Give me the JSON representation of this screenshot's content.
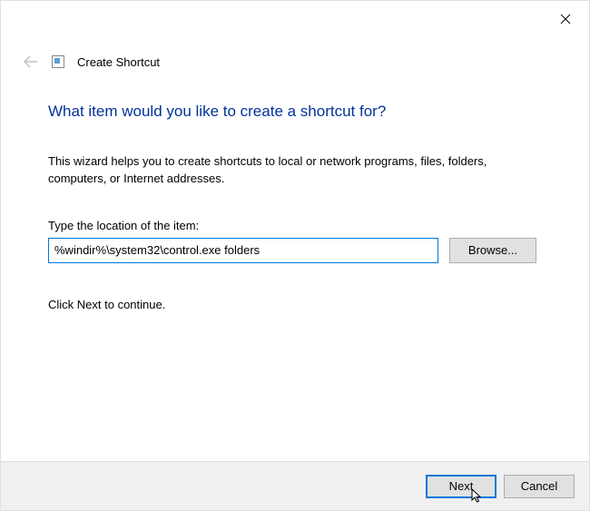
{
  "window": {
    "title": "Create Shortcut"
  },
  "main": {
    "heading": "What item would you like to create a shortcut for?",
    "description": "This wizard helps you to create shortcuts to local or network programs, files, folders, computers, or Internet addresses.",
    "location_label": "Type the location of the item:",
    "location_value": "%windir%\\system32\\control.exe folders",
    "browse_label": "Browse...",
    "continue_text": "Click Next to continue."
  },
  "footer": {
    "next_label": "Next",
    "cancel_label": "Cancel"
  }
}
